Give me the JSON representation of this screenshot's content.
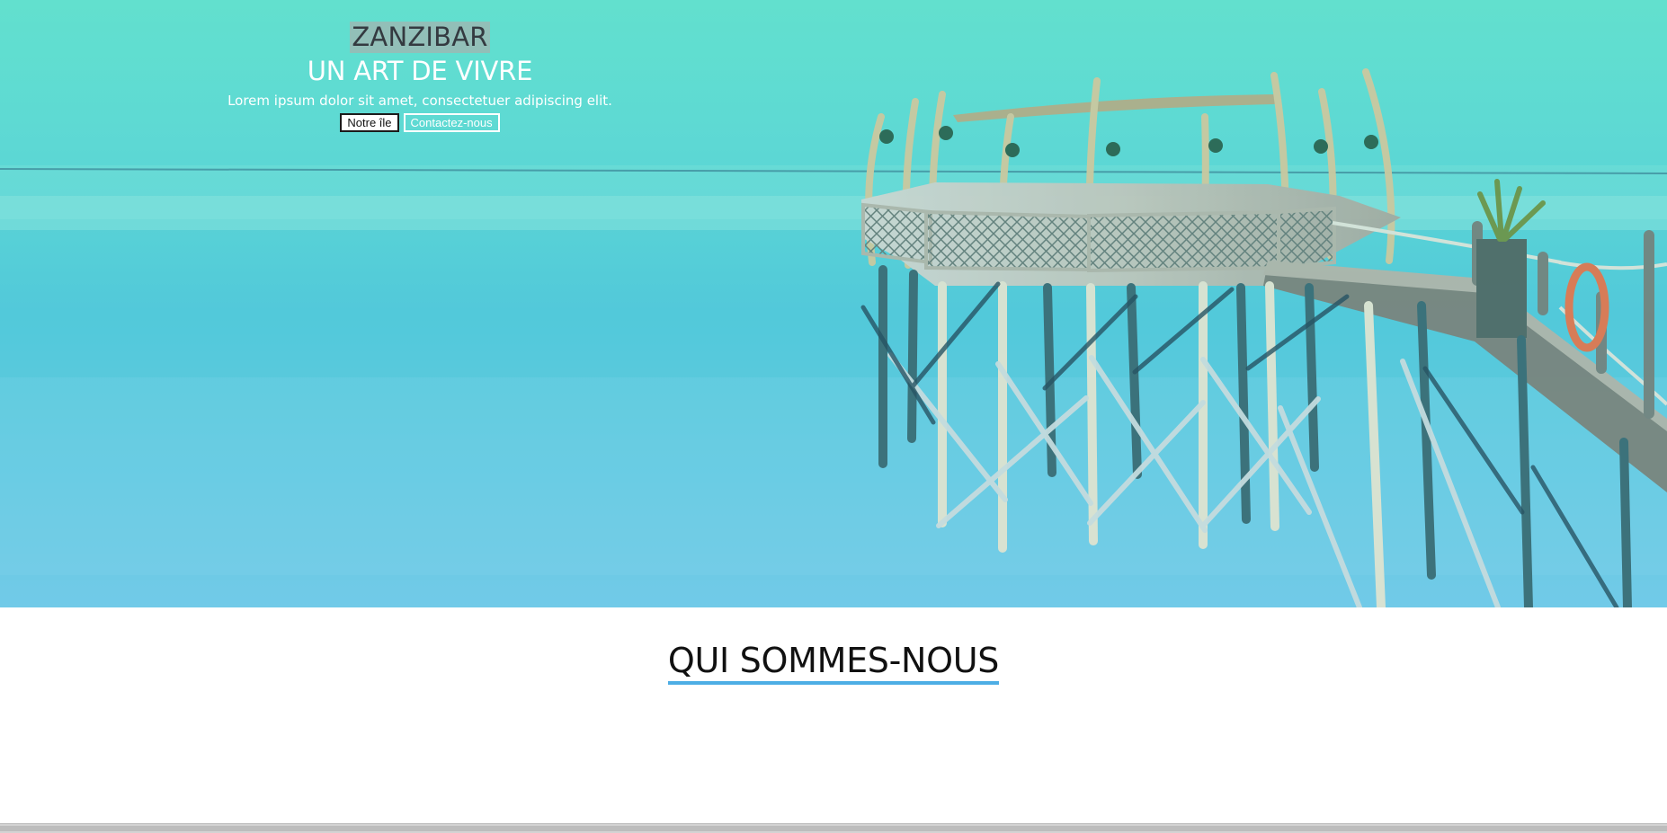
{
  "hero": {
    "title": "ZANZIBAR",
    "subtitle": "UN ART DE VIVRE",
    "text": "Lorem ipsum dolor sit amet, consectetuer adipiscing elit.",
    "buttons": {
      "island": "Notre île",
      "contact": "Contactez-nous"
    },
    "colors": {
      "sea_top": "#5de0cf",
      "sea_bottom": "#6ec8ea",
      "wood": "#d5d0c7",
      "shade": "#b8a982"
    }
  },
  "about": {
    "title": "QUI SOMMES-NOUS",
    "accent_color": "#4daee5"
  },
  "scrollbar": {
    "type": "horizontal"
  }
}
